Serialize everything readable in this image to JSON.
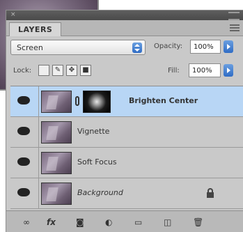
{
  "panel": {
    "tab_label": "LAYERS",
    "blend_mode": "Screen",
    "opacity_label": "Opacity:",
    "opacity_value": "100%",
    "lock_label": "Lock:",
    "fill_label": "Fill:",
    "fill_value": "100%"
  },
  "layers": [
    {
      "name": "Brighten Center",
      "selected": true,
      "has_mask": true
    },
    {
      "name": "Vignette",
      "selected": false,
      "has_mask": false
    },
    {
      "name": "Soft Focus",
      "selected": false,
      "has_mask": false
    },
    {
      "name": "Background",
      "selected": false,
      "has_mask": false,
      "locked": true
    }
  ],
  "bottom_icons": [
    "link-layers-icon",
    "fx-icon",
    "add-mask-icon",
    "adjustment-layer-icon",
    "new-group-icon",
    "new-layer-icon",
    "trash-icon"
  ],
  "colors": {
    "selected_row": "#b8d6f5",
    "accent_blue": "#2f6cc5",
    "panel": "#c9c9c9"
  }
}
